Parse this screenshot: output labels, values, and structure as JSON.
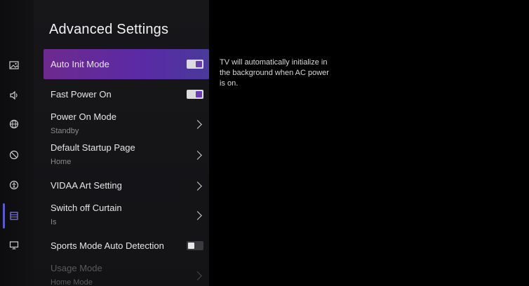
{
  "page": {
    "title": "Advanced Settings"
  },
  "rail": {
    "icons": [
      "picture-icon",
      "sound-icon",
      "network-icon",
      "display-icon",
      "accessibility-icon",
      "system-icon",
      "support-icon"
    ],
    "active_index": 5
  },
  "items": [
    {
      "label": "Auto Init Mode",
      "control": "toggle",
      "state": "on",
      "highlighted": true
    },
    {
      "label": "Fast Power On",
      "control": "toggle",
      "state": "on"
    },
    {
      "label": "Power On Mode",
      "value": "Standby",
      "control": "chevron"
    },
    {
      "label": "Default Startup Page",
      "value": "Home",
      "control": "chevron"
    },
    {
      "label": "VIDAA Art Setting",
      "control": "chevron"
    },
    {
      "label": "Switch off Curtain",
      "value": "Is",
      "control": "chevron"
    },
    {
      "label": "Sports Mode Auto Detection",
      "control": "toggle",
      "state": "off"
    },
    {
      "label": "Usage Mode",
      "value": "Home Mode",
      "control": "chevron",
      "dimmed": true
    }
  ],
  "description": "TV will automatically initialize in the background when AC power is on.",
  "colors": {
    "highlight_start": "#6d2a8e",
    "highlight_end": "#4a3a9a",
    "toggle_knob": "#6b3db0"
  }
}
